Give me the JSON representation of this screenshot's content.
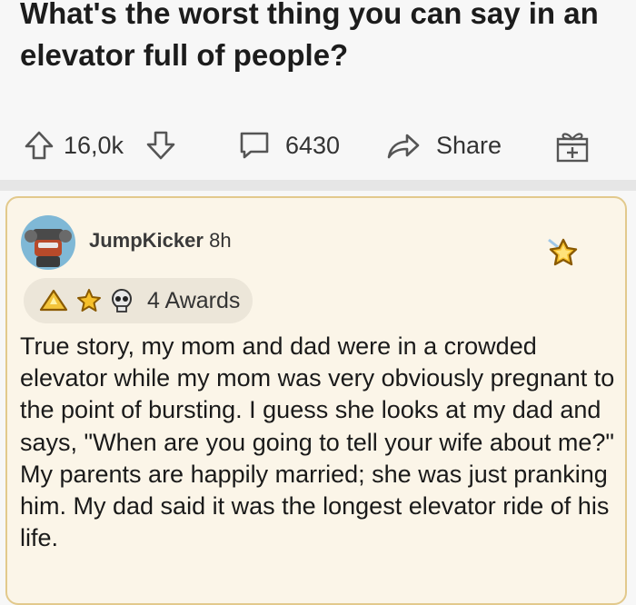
{
  "post": {
    "title": "What's the worst thing you can say in an elevator full of people?"
  },
  "actions": {
    "upvote_icon": "upvote-arrow-icon",
    "vote_count": "16,0k",
    "downvote_icon": "downvote-arrow-icon",
    "comment_icon": "comment-bubble-icon",
    "comment_count": "6430",
    "share_icon": "share-arrow-icon",
    "share_label": "Share",
    "award_icon": "gift-award-icon"
  },
  "comment": {
    "username": "JumpKicker",
    "age": "8h",
    "awards_label": "4 Awards",
    "body": "True story, my mom and dad were in a crowded elevator while my mom was very obviously pregnant to the point of bursting. I guess she looks at my dad and says, \"When are you going to tell your wife about me?\" My parents are happily married; she was just pranking him. My dad said it was the longest elevator ride of his life."
  },
  "colors": {
    "card_background": "#fbf5e8",
    "card_border": "#e2c98c",
    "gold_award": "#f6c02b",
    "text": "#1a1a1b"
  }
}
